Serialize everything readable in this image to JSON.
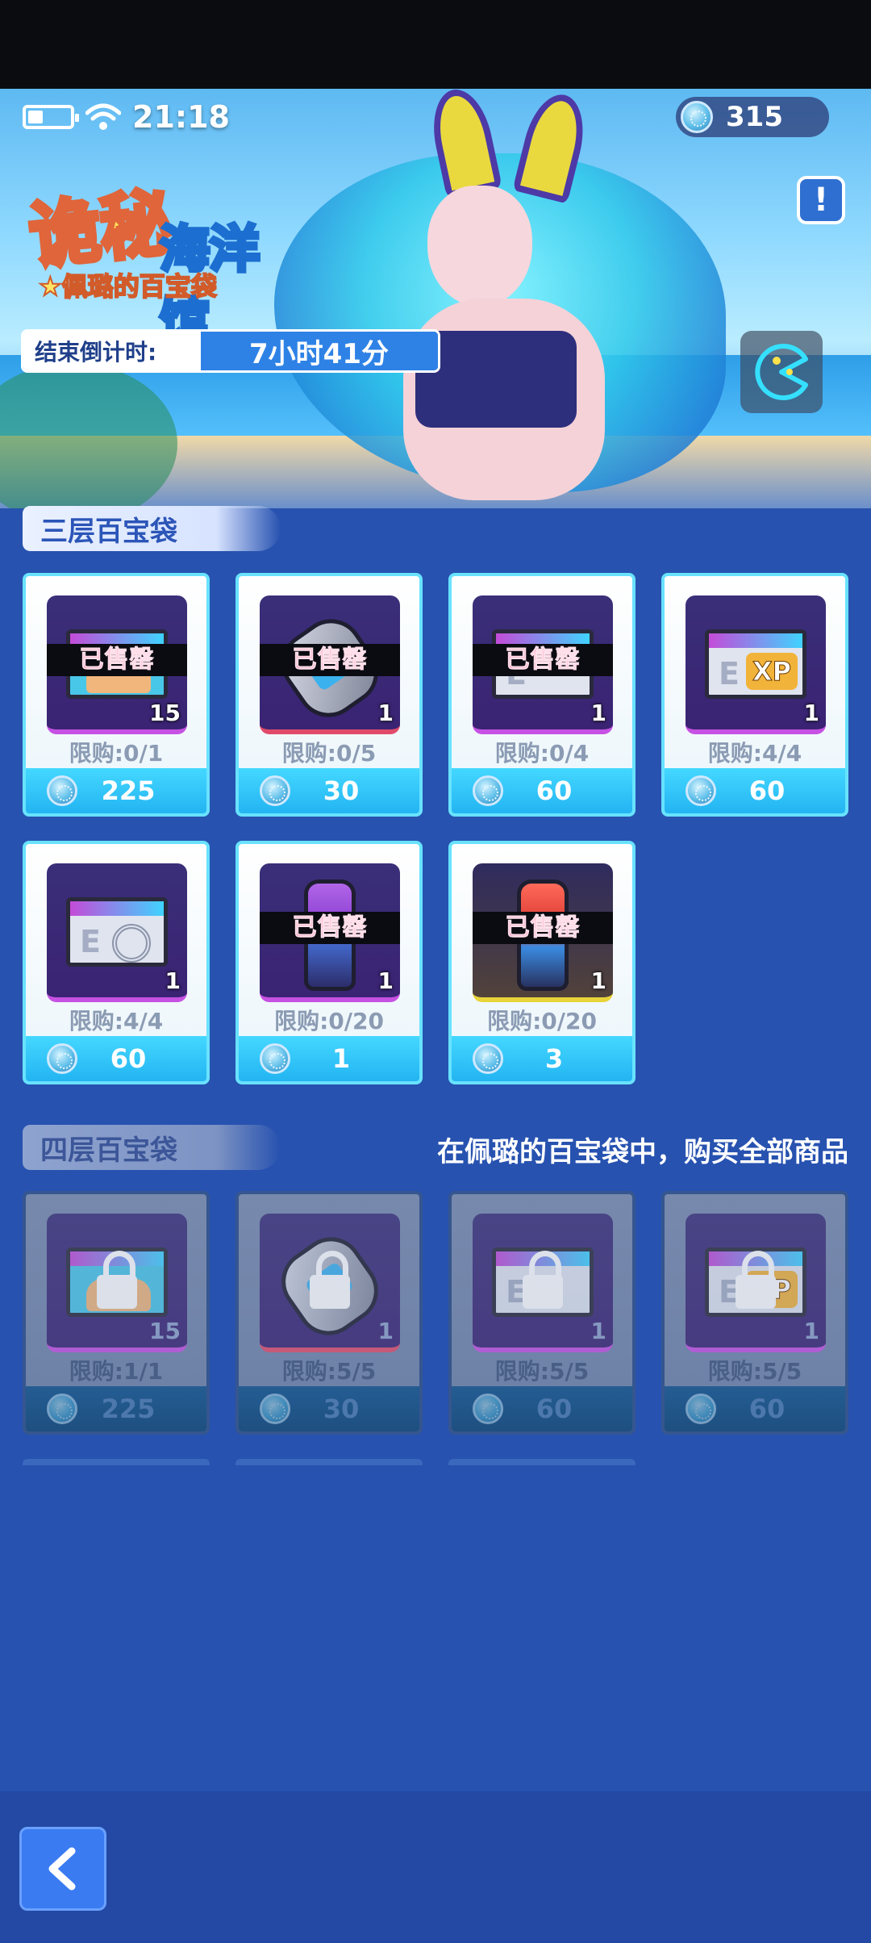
{
  "status_bar": {
    "time": "21:18"
  },
  "currency": {
    "amount": "315",
    "icon": "blue-coin-icon"
  },
  "banner": {
    "title_line1": "诡秘",
    "title_line2": "海洋馆",
    "subtitle": "★佩璐的百宝袋",
    "countdown_label": "结束倒计时:",
    "countdown_value": "7小时41分",
    "info_icon": "exclamation-icon",
    "side_icon": "pacman-chat-icon"
  },
  "section1": {
    "title": "三层百宝袋",
    "items": [
      {
        "name": "avatar-ticket",
        "qty": "15",
        "sold": "已售罄",
        "limit": "限购:0/1",
        "price": "225"
      },
      {
        "name": "bandage",
        "qty": "1",
        "sold": "已售罄",
        "limit": "限购:0/5",
        "price": "30"
      },
      {
        "name": "exp-ticket-screen",
        "qty": "1",
        "sold": "已售罄",
        "limit": "限购:0/4",
        "price": "60"
      },
      {
        "name": "xp-ticket",
        "qty": "1",
        "sold": "",
        "limit": "限购:4/4",
        "price": "60"
      },
      {
        "name": "disc-ticket",
        "qty": "1",
        "sold": "",
        "limit": "限购:4/4",
        "price": "60"
      },
      {
        "name": "purple-capsule",
        "qty": "1",
        "sold": "已售罄",
        "limit": "限购:0/20",
        "price": "1"
      },
      {
        "name": "red-capsule",
        "qty": "1",
        "sold": "已售罄",
        "limit": "限购:0/20",
        "price": "3"
      }
    ]
  },
  "section2": {
    "title": "四层百宝袋",
    "note": "在佩璐的百宝袋中，购买全部商品",
    "items": [
      {
        "name": "avatar-ticket",
        "qty": "15",
        "limit": "限购:1/1",
        "price": "225"
      },
      {
        "name": "bandage",
        "qty": "1",
        "limit": "限购:5/5",
        "price": "30"
      },
      {
        "name": "exp-ticket-screen",
        "qty": "1",
        "limit": "限购:5/5",
        "price": "60"
      },
      {
        "name": "xp-ticket",
        "qty": "1",
        "limit": "限购:5/5",
        "price": "60"
      }
    ]
  },
  "nav": {
    "back_icon": "chevron-left-icon"
  },
  "colors": {
    "accent": "#44d8ff",
    "background": "#2752b0",
    "sold_text": "#ff4f86"
  }
}
